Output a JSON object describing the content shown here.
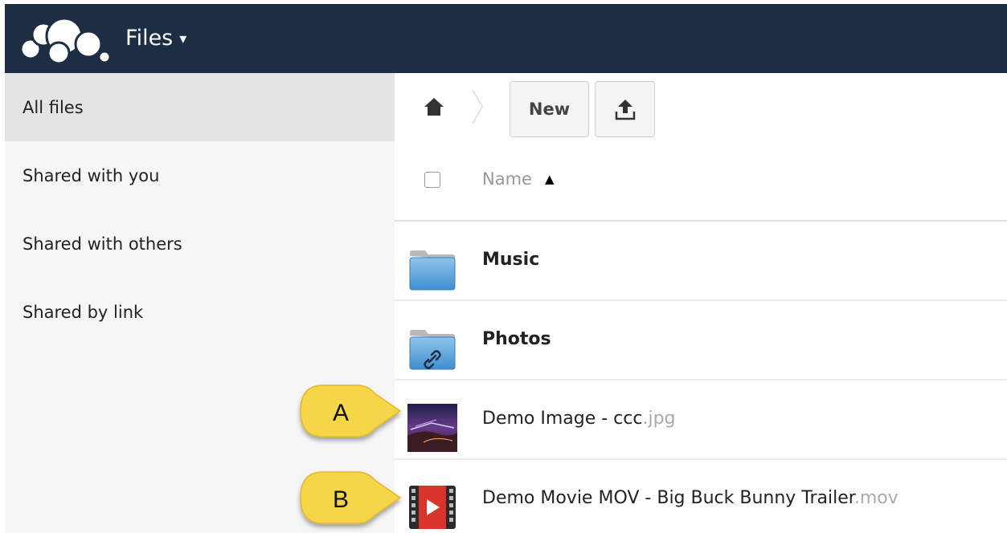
{
  "header": {
    "app_title": "Files",
    "app_caret": "▾",
    "logo_icon": "owncloud-cloud-logo",
    "background": "#1d2d44"
  },
  "sidebar": {
    "items": [
      {
        "label": "All files",
        "active": true
      },
      {
        "label": "Shared with you",
        "active": false
      },
      {
        "label": "Shared with others",
        "active": false
      },
      {
        "label": "Shared by link",
        "active": false
      }
    ]
  },
  "toolbar": {
    "home_icon": "home-icon",
    "new_label": "New",
    "upload_icon": "upload-icon"
  },
  "file_list": {
    "column_name": "Name",
    "sort_indicator": "▲",
    "rows": [
      {
        "name": "Music",
        "ext": "",
        "type": "folder",
        "icon": "folder-icon"
      },
      {
        "name": "Photos",
        "ext": "",
        "type": "shared-folder",
        "icon": "shared-folder-link-icon"
      },
      {
        "name": "Demo Image - ccc",
        "ext": ".jpg",
        "type": "image",
        "icon": "image-thumbnail"
      },
      {
        "name": "Demo Movie MOV - Big Buck Bunny Trailer",
        "ext": ".mov",
        "type": "video",
        "icon": "video-file-icon"
      }
    ]
  },
  "callouts": {
    "a": "A",
    "b": "B",
    "color": "#f6d54a"
  }
}
